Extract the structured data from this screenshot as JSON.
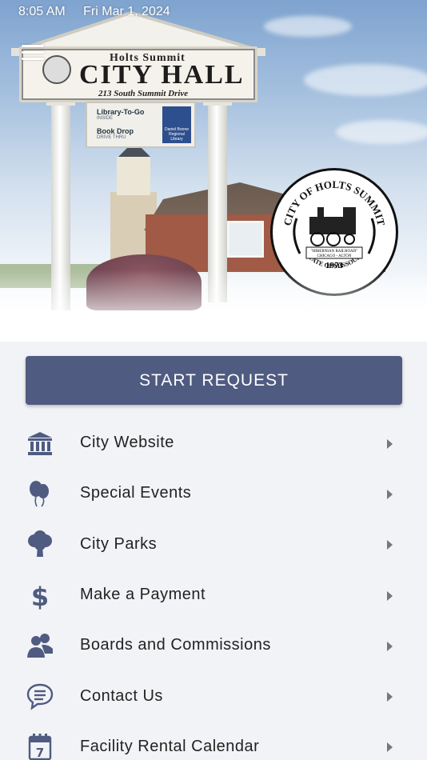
{
  "status_bar": {
    "time": "8:05 AM",
    "date": "Fri Mar 1, 2024"
  },
  "hero": {
    "sign_town": "Holts Summit",
    "sign_title": "CITY HALL",
    "sign_address": "213 South Summit Drive",
    "library_to_go": "Library-To-Go",
    "library_inside": "INSIDE",
    "book_drop": "Book Drop",
    "drive_thru": "DRIVE THRU",
    "library_name": "Daniel Boone Regional Library",
    "seal_top": "CITY OF HOLTS SUMMIT",
    "seal_banner_1": "\"HIBERNIAN RAILROAD\"",
    "seal_banner_2": "CHICAGO - ALTON",
    "seal_year": "1973",
    "seal_bottom": "STATE OF MISSOURI"
  },
  "start_button": {
    "label": "START REQUEST"
  },
  "menu": [
    {
      "label": "City Website",
      "icon": "building-icon"
    },
    {
      "label": "Special Events",
      "icon": "balloons-icon"
    },
    {
      "label": "City Parks",
      "icon": "tree-icon"
    },
    {
      "label": "Make a Payment",
      "icon": "dollar-icon"
    },
    {
      "label": "Boards and Commissions",
      "icon": "people-icon"
    },
    {
      "label": "Contact Us",
      "icon": "chat-icon"
    },
    {
      "label": "Facility Rental Calendar",
      "icon": "calendar-icon",
      "calendar_day": "7"
    }
  ],
  "colors": {
    "accent": "#4f5b80",
    "icon": "#4f5b80",
    "background": "#f2f3f6"
  }
}
